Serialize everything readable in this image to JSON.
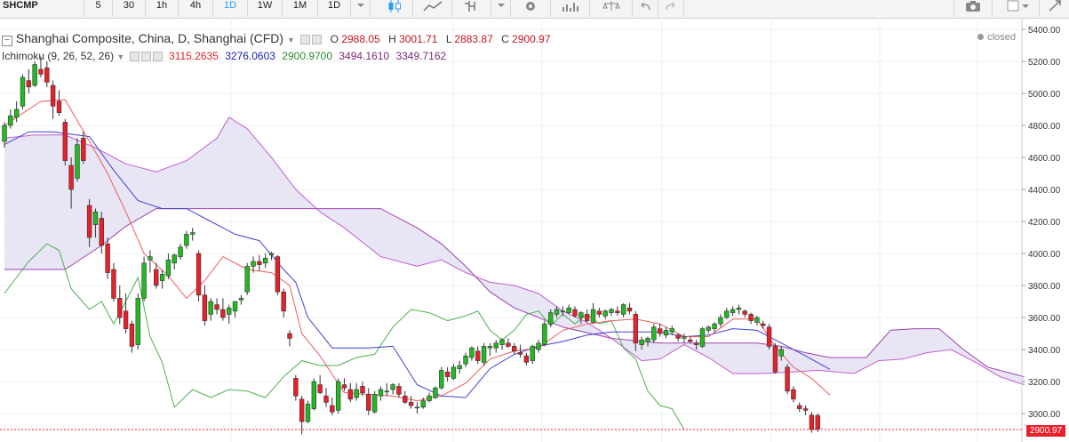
{
  "toolbar": {
    "symbol": "SHCMP",
    "intervals": [
      "5",
      "30",
      "1h",
      "4h",
      "1D",
      "1W",
      "1M",
      "1D"
    ],
    "active_interval_index": 4,
    "tool_icons": [
      "candlestick-icon",
      "line-style-icon",
      "indicator-icon",
      "settings-icon",
      "bar-chart-icon",
      "scales-icon",
      "undo-icon",
      "redo-icon",
      "camera-icon",
      "layout-icon",
      "expand-icon"
    ]
  },
  "legend": {
    "title": "Shanghai Composite, China, D, Shanghai (CFD)",
    "o_label": "O",
    "o": "2988.05",
    "h_label": "H",
    "h": "3001.71",
    "l_label": "L",
    "l": "2883.87",
    "c_label": "C",
    "c": "2900.97",
    "status": "closed",
    "indicator": "Ichimoku (9, 26, 52, 26)",
    "indicator_values": [
      "3115.2635",
      "3276.0603",
      "2900.9700",
      "3494.1610",
      "3349.7162"
    ]
  },
  "last_price": "2900.97",
  "colors": {
    "up": "#22b922",
    "down": "#e8202a",
    "tenkan": "#ef5c5c",
    "kijun": "#3f3fd6",
    "chikou": "#4caf50",
    "senkou_a": "#c25bd0",
    "senkou_b": "#9c42b0",
    "cloud": "#e8e6f5",
    "accent": "#2a9df4"
  },
  "chart_data": {
    "type": "candlestick",
    "ylim": [
      2900,
      5400
    ],
    "y_ticks": [
      "5400.00",
      "5200.00",
      "5000.00",
      "4800.00",
      "4600.00",
      "4400.00",
      "4200.00",
      "4000.00",
      "3800.00",
      "3600.00",
      "3400.00",
      "3200.00",
      "3000.00"
    ],
    "candles": [
      [
        4700,
        4820,
        4660,
        4800
      ],
      [
        4800,
        4900,
        4780,
        4860
      ],
      [
        4850,
        4950,
        4820,
        4900
      ],
      [
        4920,
        5120,
        4900,
        5100
      ],
      [
        5080,
        5150,
        5000,
        5040
      ],
      [
        5050,
        5200,
        5040,
        5180
      ],
      [
        5150,
        5230,
        5100,
        5120
      ],
      [
        5160,
        5200,
        5040,
        5070
      ],
      [
        5050,
        5080,
        4840,
        4920
      ],
      [
        4950,
        5020,
        4860,
        4880
      ],
      [
        4820,
        4840,
        4550,
        4580
      ],
      [
        4550,
        4600,
        4280,
        4400
      ],
      [
        4470,
        4720,
        4450,
        4680
      ],
      [
        4720,
        4760,
        4560,
        4580
      ],
      [
        4300,
        4340,
        4040,
        4100
      ],
      [
        4180,
        4280,
        4100,
        4260
      ],
      [
        4220,
        4260,
        4000,
        4050
      ],
      [
        4060,
        4100,
        3840,
        3880
      ],
      [
        3900,
        3940,
        3700,
        3720
      ],
      [
        3720,
        3800,
        3560,
        3600
      ],
      [
        3640,
        3750,
        3500,
        3530
      ],
      [
        3560,
        3580,
        3380,
        3420
      ],
      [
        3430,
        3750,
        3400,
        3720
      ],
      [
        3720,
        3980,
        3700,
        3940
      ],
      [
        3960,
        4020,
        3880,
        3980
      ],
      [
        3900,
        3940,
        3780,
        3800
      ],
      [
        3830,
        3900,
        3780,
        3870
      ],
      [
        3860,
        4000,
        3840,
        3960
      ],
      [
        3940,
        4000,
        3900,
        3990
      ],
      [
        3980,
        4060,
        3960,
        4040
      ],
      [
        4050,
        4140,
        4030,
        4120
      ],
      [
        4120,
        4160,
        4080,
        4130
      ],
      [
        4000,
        4020,
        3700,
        3740
      ],
      [
        3740,
        3800,
        3550,
        3580
      ],
      [
        3620,
        3720,
        3580,
        3700
      ],
      [
        3680,
        3720,
        3620,
        3650
      ],
      [
        3650,
        3720,
        3580,
        3600
      ],
      [
        3620,
        3680,
        3560,
        3660
      ],
      [
        3640,
        3700,
        3600,
        3700
      ],
      [
        3710,
        3740,
        3680,
        3720
      ],
      [
        3760,
        3940,
        3740,
        3920
      ],
      [
        3920,
        3980,
        3880,
        3950
      ],
      [
        3950,
        3990,
        3890,
        3930
      ],
      [
        3940,
        4000,
        3910,
        3970
      ],
      [
        3990,
        4010,
        3960,
        4000
      ],
      [
        3980,
        3990,
        3740,
        3760
      ],
      [
        3760,
        3780,
        3600,
        3640
      ],
      [
        3500,
        3520,
        3420,
        3470
      ],
      [
        3220,
        3240,
        3080,
        3110
      ],
      [
        3090,
        3110,
        2870,
        2950
      ],
      [
        2950,
        3080,
        2940,
        3060
      ],
      [
        3030,
        3220,
        3020,
        3200
      ],
      [
        3180,
        3240,
        3120,
        3130
      ],
      [
        3110,
        3160,
        3040,
        3070
      ],
      [
        3050,
        3100,
        2990,
        3010
      ],
      [
        3020,
        3220,
        3000,
        3200
      ],
      [
        3180,
        3220,
        3140,
        3160
      ],
      [
        3150,
        3190,
        3070,
        3090
      ],
      [
        3100,
        3190,
        3080,
        3150
      ],
      [
        3170,
        3200,
        3110,
        3130
      ],
      [
        3120,
        3160,
        2990,
        3020
      ],
      [
        3010,
        3140,
        3000,
        3120
      ],
      [
        3110,
        3170,
        3080,
        3150
      ],
      [
        3140,
        3190,
        3110,
        3140
      ],
      [
        3150,
        3190,
        3120,
        3180
      ],
      [
        3170,
        3190,
        3100,
        3120
      ],
      [
        3110,
        3140,
        3060,
        3070
      ],
      [
        3070,
        3110,
        3030,
        3050
      ],
      [
        3040,
        3070,
        3000,
        3040
      ],
      [
        3040,
        3100,
        3030,
        3080
      ],
      [
        3080,
        3130,
        3070,
        3110
      ],
      [
        3100,
        3170,
        3090,
        3160
      ],
      [
        3160,
        3290,
        3150,
        3270
      ],
      [
        3260,
        3290,
        3200,
        3230
      ],
      [
        3220,
        3310,
        3210,
        3290
      ],
      [
        3280,
        3330,
        3250,
        3300
      ],
      [
        3310,
        3380,
        3290,
        3360
      ],
      [
        3350,
        3420,
        3330,
        3410
      ],
      [
        3390,
        3420,
        3310,
        3330
      ],
      [
        3320,
        3440,
        3300,
        3420
      ],
      [
        3410,
        3440,
        3360,
        3420
      ],
      [
        3410,
        3460,
        3380,
        3440
      ],
      [
        3430,
        3470,
        3400,
        3460
      ],
      [
        3440,
        3470,
        3410,
        3420
      ],
      [
        3420,
        3440,
        3370,
        3390
      ],
      [
        3380,
        3430,
        3350,
        3370
      ],
      [
        3360,
        3380,
        3300,
        3320
      ],
      [
        3330,
        3430,
        3310,
        3420
      ],
      [
        3400,
        3460,
        3380,
        3440
      ],
      [
        3430,
        3580,
        3420,
        3560
      ],
      [
        3560,
        3650,
        3540,
        3630
      ],
      [
        3620,
        3670,
        3600,
        3650
      ],
      [
        3640,
        3670,
        3610,
        3640
      ],
      [
        3630,
        3680,
        3620,
        3660
      ],
      [
        3650,
        3670,
        3600,
        3610
      ],
      [
        3600,
        3640,
        3560,
        3630
      ],
      [
        3620,
        3650,
        3570,
        3580
      ],
      [
        3570,
        3690,
        3560,
        3650
      ],
      [
        3640,
        3660,
        3600,
        3620
      ],
      [
        3610,
        3650,
        3590,
        3640
      ],
      [
        3630,
        3660,
        3610,
        3650
      ],
      [
        3640,
        3670,
        3610,
        3630
      ],
      [
        3620,
        3690,
        3600,
        3680
      ],
      [
        3660,
        3690,
        3620,
        3640
      ],
      [
        3620,
        3640,
        3390,
        3440
      ],
      [
        3430,
        3480,
        3400,
        3460
      ],
      [
        3450,
        3480,
        3420,
        3470
      ],
      [
        3460,
        3560,
        3440,
        3540
      ],
      [
        3530,
        3560,
        3480,
        3500
      ],
      [
        3490,
        3540,
        3470,
        3520
      ],
      [
        3510,
        3550,
        3490,
        3530
      ],
      [
        3490,
        3500,
        3450,
        3470
      ],
      [
        3470,
        3500,
        3440,
        3480
      ],
      [
        3460,
        3480,
        3440,
        3450
      ],
      [
        3440,
        3460,
        3400,
        3430
      ],
      [
        3420,
        3540,
        3410,
        3530
      ],
      [
        3520,
        3550,
        3500,
        3540
      ],
      [
        3530,
        3570,
        3510,
        3560
      ],
      [
        3560,
        3620,
        3540,
        3600
      ],
      [
        3600,
        3660,
        3590,
        3640
      ],
      [
        3630,
        3670,
        3610,
        3650
      ],
      [
        3650,
        3680,
        3620,
        3660
      ],
      [
        3640,
        3650,
        3600,
        3620
      ],
      [
        3620,
        3630,
        3560,
        3580
      ],
      [
        3570,
        3610,
        3550,
        3600
      ],
      [
        3560,
        3580,
        3530,
        3550
      ],
      [
        3540,
        3560,
        3400,
        3420
      ],
      [
        3420,
        3440,
        3250,
        3260
      ],
      [
        3360,
        3420,
        3330,
        3400
      ],
      [
        3290,
        3310,
        3120,
        3140
      ],
      [
        3150,
        3170,
        3070,
        3090
      ],
      [
        3050,
        3070,
        3010,
        3030
      ],
      [
        3030,
        3050,
        2990,
        3020
      ],
      [
        2990,
        3010,
        2880,
        2900
      ],
      [
        2988,
        3002,
        2884,
        2901
      ]
    ],
    "tenkan": [
      [
        0,
        4800
      ],
      [
        6,
        4950
      ],
      [
        10,
        4960
      ],
      [
        14,
        4700
      ],
      [
        17,
        4500
      ],
      [
        20,
        4260
      ],
      [
        23,
        4000
      ],
      [
        27,
        3860
      ],
      [
        30,
        3720
      ],
      [
        33,
        3830
      ],
      [
        36,
        3980
      ],
      [
        40,
        3900
      ],
      [
        44,
        3880
      ],
      [
        47,
        3800
      ],
      [
        49,
        3500
      ],
      [
        52,
        3360
      ],
      [
        56,
        3130
      ],
      [
        60,
        3120
      ],
      [
        64,
        3110
      ],
      [
        68,
        3080
      ],
      [
        72,
        3110
      ],
      [
        76,
        3190
      ],
      [
        80,
        3340
      ],
      [
        84,
        3390
      ],
      [
        88,
        3410
      ],
      [
        92,
        3520
      ],
      [
        96,
        3560
      ],
      [
        100,
        3580
      ],
      [
        104,
        3590
      ],
      [
        108,
        3560
      ],
      [
        112,
        3480
      ],
      [
        116,
        3480
      ],
      [
        120,
        3590
      ],
      [
        124,
        3590
      ],
      [
        127,
        3420
      ],
      [
        130,
        3290
      ],
      [
        133,
        3220
      ],
      [
        136,
        3115
      ]
    ],
    "kijun": [
      [
        0,
        4680
      ],
      [
        4,
        4760
      ],
      [
        8,
        4760
      ],
      [
        14,
        4730
      ],
      [
        18,
        4520
      ],
      [
        22,
        4330
      ],
      [
        26,
        4280
      ],
      [
        30,
        4280
      ],
      [
        34,
        4200
      ],
      [
        38,
        4120
      ],
      [
        42,
        4080
      ],
      [
        46,
        3900
      ],
      [
        48,
        3820
      ],
      [
        50,
        3600
      ],
      [
        54,
        3410
      ],
      [
        60,
        3410
      ],
      [
        64,
        3420
      ],
      [
        68,
        3180
      ],
      [
        72,
        3110
      ],
      [
        76,
        3100
      ],
      [
        80,
        3280
      ],
      [
        84,
        3370
      ],
      [
        88,
        3420
      ],
      [
        92,
        3450
      ],
      [
        96,
        3490
      ],
      [
        100,
        3510
      ],
      [
        104,
        3510
      ],
      [
        108,
        3510
      ],
      [
        112,
        3480
      ],
      [
        116,
        3490
      ],
      [
        120,
        3530
      ],
      [
        124,
        3520
      ],
      [
        128,
        3440
      ],
      [
        132,
        3360
      ],
      [
        136,
        3276
      ]
    ],
    "chikou": [
      [
        0,
        3750
      ],
      [
        4,
        3950
      ],
      [
        7,
        4060
      ],
      [
        9,
        4020
      ],
      [
        11,
        3780
      ],
      [
        14,
        3650
      ],
      [
        16,
        3700
      ],
      [
        18,
        3560
      ],
      [
        20,
        3700
      ],
      [
        22,
        3850
      ],
      [
        24,
        3480
      ],
      [
        26,
        3320
      ],
      [
        28,
        3040
      ],
      [
        31,
        3150
      ],
      [
        34,
        3100
      ],
      [
        37,
        3150
      ],
      [
        40,
        3140
      ],
      [
        43,
        3100
      ],
      [
        46,
        3230
      ],
      [
        49,
        3330
      ],
      [
        52,
        3300
      ],
      [
        55,
        3300
      ],
      [
        58,
        3350
      ],
      [
        61,
        3370
      ],
      [
        64,
        3540
      ],
      [
        67,
        3650
      ],
      [
        70,
        3630
      ],
      [
        73,
        3580
      ],
      [
        76,
        3610
      ],
      [
        78,
        3640
      ],
      [
        80,
        3520
      ],
      [
        82,
        3460
      ],
      [
        84,
        3520
      ],
      [
        86,
        3620
      ],
      [
        88,
        3640
      ],
      [
        90,
        3550
      ],
      [
        92,
        3620
      ],
      [
        94,
        3560
      ],
      [
        96,
        3620
      ],
      [
        98,
        3560
      ],
      [
        100,
        3580
      ],
      [
        102,
        3410
      ],
      [
        104,
        3340
      ],
      [
        106,
        3140
      ],
      [
        108,
        3050
      ],
      [
        110,
        3030
      ],
      [
        112,
        2900
      ]
    ],
    "senkou_a": [
      [
        0,
        4720
      ],
      [
        5,
        4740
      ],
      [
        10,
        4740
      ],
      [
        15,
        4660
      ],
      [
        20,
        4560
      ],
      [
        25,
        4510
      ],
      [
        30,
        4580
      ],
      [
        35,
        4720
      ],
      [
        37,
        4850
      ],
      [
        40,
        4780
      ],
      [
        44,
        4600
      ],
      [
        48,
        4400
      ],
      [
        52,
        4260
      ],
      [
        56,
        4160
      ],
      [
        62,
        3980
      ],
      [
        68,
        3920
      ],
      [
        72,
        3960
      ],
      [
        76,
        3880
      ],
      [
        80,
        3820
      ],
      [
        84,
        3800
      ],
      [
        88,
        3750
      ],
      [
        92,
        3640
      ],
      [
        96,
        3570
      ],
      [
        100,
        3470
      ],
      [
        105,
        3330
      ],
      [
        108,
        3340
      ],
      [
        112,
        3430
      ],
      [
        116,
        3350
      ],
      [
        120,
        3250
      ],
      [
        125,
        3250
      ],
      [
        130,
        3260
      ],
      [
        134,
        3270
      ],
      [
        140,
        3250
      ],
      [
        144,
        3330
      ],
      [
        148,
        3340
      ],
      [
        152,
        3380
      ],
      [
        156,
        3400
      ],
      [
        160,
        3320
      ],
      [
        164,
        3230
      ],
      [
        168,
        3180
      ]
    ],
    "senkou_b": [
      [
        0,
        3900
      ],
      [
        10,
        3900
      ],
      [
        16,
        4050
      ],
      [
        20,
        4170
      ],
      [
        25,
        4280
      ],
      [
        30,
        4280
      ],
      [
        40,
        4280
      ],
      [
        55,
        4280
      ],
      [
        62,
        4280
      ],
      [
        68,
        4160
      ],
      [
        72,
        4060
      ],
      [
        76,
        3920
      ],
      [
        80,
        3760
      ],
      [
        84,
        3660
      ],
      [
        88,
        3600
      ],
      [
        92,
        3540
      ],
      [
        100,
        3470
      ],
      [
        108,
        3440
      ],
      [
        116,
        3440
      ],
      [
        124,
        3440
      ],
      [
        128,
        3420
      ],
      [
        132,
        3380
      ],
      [
        136,
        3350
      ],
      [
        142,
        3350
      ],
      [
        146,
        3520
      ],
      [
        150,
        3530
      ],
      [
        154,
        3530
      ],
      [
        158,
        3400
      ],
      [
        162,
        3290
      ],
      [
        166,
        3250
      ],
      [
        168,
        3230
      ]
    ]
  }
}
